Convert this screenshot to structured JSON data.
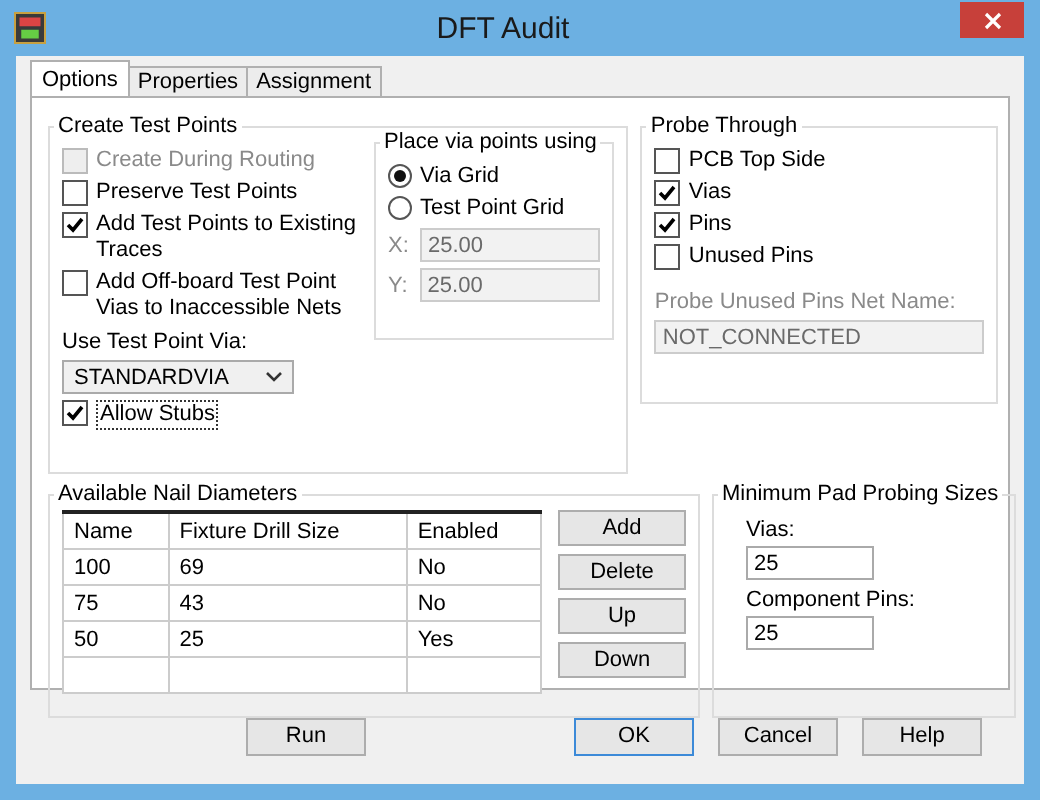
{
  "window": {
    "title": "DFT Audit"
  },
  "tabs": [
    {
      "label": "Options",
      "selected": true
    },
    {
      "label": "Properties",
      "selected": false
    },
    {
      "label": "Assignment",
      "selected": false
    }
  ],
  "create_test_points": {
    "title": "Create Test Points",
    "items": [
      {
        "label": "Create During Routing",
        "checked": false,
        "disabled": true
      },
      {
        "label": "Preserve Test Points",
        "checked": false,
        "disabled": false
      },
      {
        "label": "Add Test Points to Existing Traces",
        "checked": true,
        "disabled": false
      },
      {
        "label": "Add Off-board Test Point Vias to Inaccessible Nets",
        "checked": false,
        "disabled": false
      }
    ],
    "via_label": "Use Test Point Via:",
    "via_dropdown": {
      "value": "STANDARDVIA"
    },
    "allow_stubs": {
      "label": "Allow Stubs",
      "checked": true
    }
  },
  "place_via": {
    "title": "Place via points using",
    "options": [
      {
        "label": "Via Grid",
        "selected": true
      },
      {
        "label": "Test Point Grid",
        "selected": false
      }
    ],
    "fields": [
      {
        "label": "X:",
        "value": "25.00",
        "disabled": true
      },
      {
        "label": "Y:",
        "value": "25.00",
        "disabled": true
      }
    ]
  },
  "probe_through": {
    "title": "Probe Through",
    "items": [
      {
        "label": "PCB Top Side",
        "checked": false
      },
      {
        "label": "Vias",
        "checked": true
      },
      {
        "label": "Pins",
        "checked": true
      },
      {
        "label": "Unused Pins",
        "checked": false
      }
    ],
    "net_name": {
      "label": "Probe Unused Pins Net Name:",
      "value": "NOT_CONNECTED",
      "disabled": true
    }
  },
  "nail_diameters": {
    "title": "Available Nail Diameters",
    "columns": [
      "Name",
      "Fixture Drill Size",
      "Enabled"
    ],
    "rows": [
      [
        "100",
        "69",
        "No"
      ],
      [
        "75",
        "43",
        "No"
      ],
      [
        "50",
        "25",
        "Yes"
      ]
    ],
    "buttons": [
      "Add",
      "Delete",
      "Up",
      "Down"
    ]
  },
  "min_pad": {
    "title": "Minimum Pad Probing Sizes",
    "fields": [
      {
        "label": "Vias:",
        "value": "25"
      },
      {
        "label": "Component Pins:",
        "value": "25"
      }
    ]
  },
  "buttons": [
    {
      "label": "Run",
      "default": false
    },
    {
      "label": "OK",
      "default": true
    },
    {
      "label": "Cancel",
      "default": false
    },
    {
      "label": "Help",
      "default": false
    }
  ]
}
